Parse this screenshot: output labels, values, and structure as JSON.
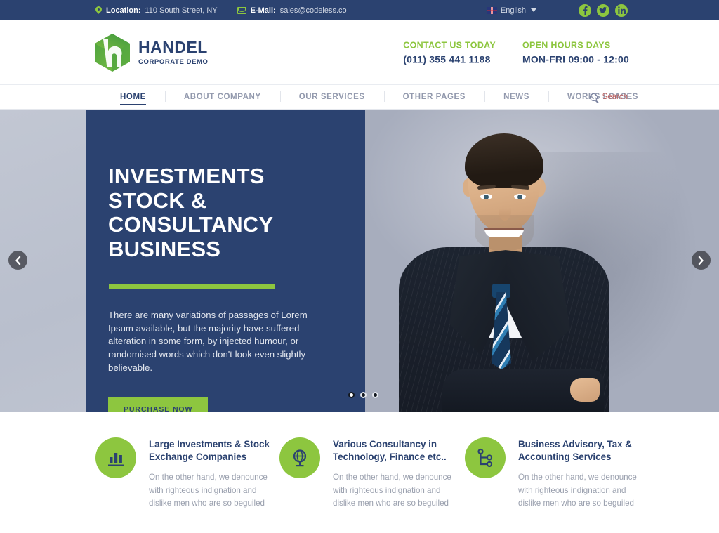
{
  "topbar": {
    "location_label": "Location:",
    "location_value": "110 South Street, NY",
    "email_label": "E-Mail:",
    "email_value": "sales@codeless.co",
    "language": "English",
    "socials": [
      {
        "name": "facebook-icon",
        "glyph": "f"
      },
      {
        "name": "twitter-icon",
        "glyph": "t"
      },
      {
        "name": "linkedin-icon",
        "glyph": "in"
      }
    ]
  },
  "header": {
    "logo_title": "HANDEL",
    "logo_subtitle": "CORPORATE DEMO",
    "contact": {
      "title": "CONTACT US TODAY",
      "value": "(011) 355 441 1188"
    },
    "hours": {
      "title": "OPEN HOURS DAYS",
      "value": "MON-FRI 09:00 - 12:00"
    }
  },
  "nav": {
    "items": [
      {
        "label": "HOME",
        "active": true
      },
      {
        "label": "ABOUT COMPANY",
        "active": false
      },
      {
        "label": "OUR SERVICES",
        "active": false
      },
      {
        "label": "OTHER PAGES",
        "active": false
      },
      {
        "label": "NEWS",
        "active": false
      },
      {
        "label": "WORKS / CASES",
        "active": false
      }
    ],
    "search_label": "Search"
  },
  "hero": {
    "title_line1": "INVESTMENTS STOCK &",
    "title_line2": "CONSULTANCY BUSINESS",
    "paragraph": "There are many variations of passages of Lorem Ipsum available, but the majority have suffered alteration in some form, by injected humour, or randomised words which don't look even slightly believable.",
    "button_label": "PURCHASE NOW",
    "slide_count": 3,
    "active_slide": 1,
    "prev_label": "Previous slide",
    "next_label": "Next slide",
    "photo_alt": "Smiling businessman in dark pinstripe suit with blue striped tie, arms crossed"
  },
  "features": [
    {
      "icon": "bar-chart-icon",
      "title": "Large Investments & Stock Exchange Companies",
      "text": "On the other hand, we denounce with righteous indignation and dislike men who are so beguiled"
    },
    {
      "icon": "globe-icon",
      "title": "Various Consultancy in Technology, Finance etc..",
      "text": "On the other hand, we denounce with righteous indignation and dislike men who are so beguiled"
    },
    {
      "icon": "network-icon",
      "title": "Business Advisory, Tax & Accounting Services",
      "text": "On the other hand, we denounce with righteous indignation and dislike men who are so beguiled"
    }
  ],
  "colors": {
    "navy": "#2b4270",
    "green": "#8dc63f",
    "muted_text": "#9aa0ae",
    "nav_inactive": "#9299ad",
    "search_accent": "#b85c5c"
  }
}
